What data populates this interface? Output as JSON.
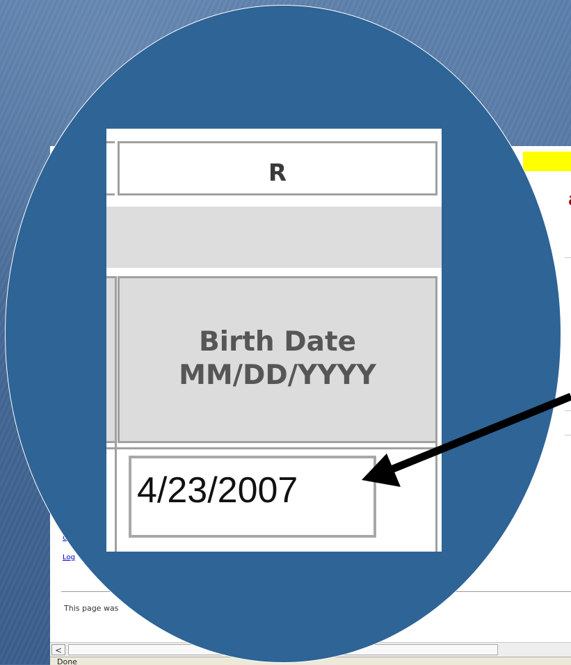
{
  "browser": {
    "heading_fragment": "ar",
    "links": [
      "C",
      "Log"
    ],
    "footer_text": "This page was",
    "scroll_left_glyph": "<",
    "status": "Done"
  },
  "zoom": {
    "column_header": "R",
    "field_label_line1": "Birth Date",
    "field_label_line2": "MM/DD/YYYY",
    "birth_date_value": "4/23/2007"
  },
  "colors": {
    "circle": "#2e6496",
    "heading": "#8b0000",
    "highlight": "#ffff00"
  }
}
